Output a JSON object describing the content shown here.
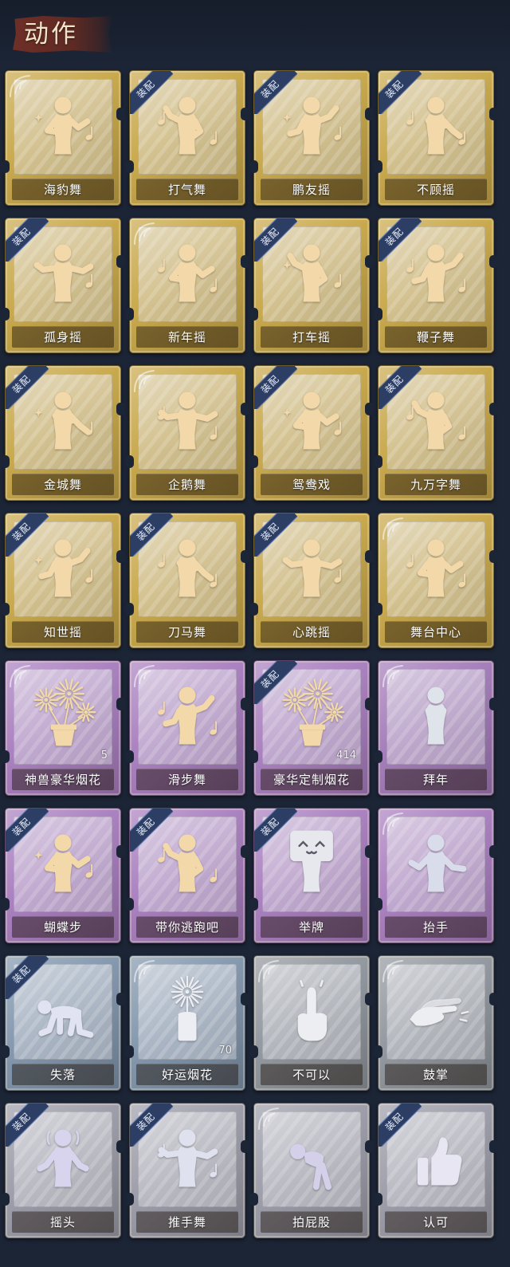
{
  "header": {
    "title": "动作"
  },
  "equip_badge_label": "装配",
  "colors": {
    "page_background": "#1c2536",
    "banner": "#5e2a24",
    "badge": "#2c3e64",
    "label_text": "#ffffff"
  },
  "actions": [
    {
      "name": "海豹舞",
      "equipped": false,
      "icon": "dancing-figure-icon",
      "color": "#c7a646",
      "icon_color": "#f3d8a9"
    },
    {
      "name": "打气舞",
      "equipped": true,
      "icon": "dancing-figure-icon",
      "color": "#c7a646",
      "icon_color": "#f3d8a9"
    },
    {
      "name": "鹏友摇",
      "equipped": true,
      "icon": "dancing-figure-icon",
      "color": "#c7a646",
      "icon_color": "#f3d8a9"
    },
    {
      "name": "不顾摇",
      "equipped": true,
      "icon": "dancing-figure-icon",
      "color": "#c7a646",
      "icon_color": "#f3d8a9"
    },
    {
      "name": "孤身摇",
      "equipped": true,
      "icon": "dancing-figure-icon",
      "color": "#c7a646",
      "icon_color": "#f3d8a9"
    },
    {
      "name": "新年摇",
      "equipped": false,
      "icon": "dancing-figure-icon",
      "color": "#c7a646",
      "icon_color": "#f3d8a9"
    },
    {
      "name": "打车摇",
      "equipped": true,
      "icon": "dancing-figure-icon",
      "color": "#c7a646",
      "icon_color": "#f3d8a9"
    },
    {
      "name": "鞭子舞",
      "equipped": true,
      "icon": "dancing-figure-icon",
      "color": "#c7a646",
      "icon_color": "#f3d8a9"
    },
    {
      "name": "金城舞",
      "equipped": true,
      "icon": "dancing-figure-icon",
      "color": "#c7a646",
      "icon_color": "#f3d8a9"
    },
    {
      "name": "企鹅舞",
      "equipped": false,
      "icon": "dancing-figure-icon",
      "color": "#c7a646",
      "icon_color": "#f3d8a9"
    },
    {
      "name": "鸳鸯戏",
      "equipped": true,
      "icon": "dancing-figure-icon",
      "color": "#c7a646",
      "icon_color": "#f3d8a9"
    },
    {
      "name": "九万字舞",
      "equipped": true,
      "icon": "dancing-figure-icon",
      "color": "#c7a646",
      "icon_color": "#f3d8a9"
    },
    {
      "name": "知世摇",
      "equipped": true,
      "icon": "dancing-figure-icon",
      "color": "#c7a646",
      "icon_color": "#f3d8a9"
    },
    {
      "name": "刀马舞",
      "equipped": true,
      "icon": "dancing-figure-icon",
      "color": "#c7a646",
      "icon_color": "#f3d8a9"
    },
    {
      "name": "心跳摇",
      "equipped": true,
      "icon": "dancing-figure-icon",
      "color": "#c7a646",
      "icon_color": "#f3d8a9"
    },
    {
      "name": "舞台中心",
      "equipped": false,
      "icon": "dancing-figure-icon",
      "color": "#c7a646",
      "icon_color": "#f3d8a9"
    },
    {
      "name": "神兽豪华烟花",
      "equipped": false,
      "icon": "fireworks-icon",
      "color": "#a77cbe",
      "icon_color": "#f3d8a9",
      "count": 5
    },
    {
      "name": "滑步舞",
      "equipped": false,
      "icon": "dancing-figure-icon",
      "color": "#a77cbe",
      "icon_color": "#f3d8a9"
    },
    {
      "name": "豪华定制烟花",
      "equipped": true,
      "icon": "fireworks-icon",
      "color": "#a77cbe",
      "icon_color": "#f3d8a9",
      "count": 414
    },
    {
      "name": "拜年",
      "equipped": false,
      "icon": "greeting-figure-icon",
      "color": "#a179b8",
      "icon_color": "#dfe3ea"
    },
    {
      "name": "蝴蝶步",
      "equipped": true,
      "icon": "dancing-figure-icon",
      "color": "#a77cbe",
      "icon_color": "#f3d8a9"
    },
    {
      "name": "带你逃跑吧",
      "equipped": true,
      "icon": "dancing-figure-icon",
      "color": "#a77cbe",
      "icon_color": "#f3d8a9"
    },
    {
      "name": "举牌",
      "equipped": true,
      "icon": "sign-holding-figure-icon",
      "color": "#a77cbe",
      "icon_color": "#e6e8ee"
    },
    {
      "name": "抬手",
      "equipped": false,
      "icon": "raised-hand-figure-icon",
      "color": "#a77cbe",
      "icon_color": "#d9dcea"
    },
    {
      "name": "失落",
      "equipped": true,
      "icon": "crawling-figure-icon",
      "color": "#7f94ab",
      "icon_color": "#e2e3f2"
    },
    {
      "name": "好运烟花",
      "equipped": false,
      "icon": "firecracker-icon",
      "color": "#7f94ab",
      "icon_color": "#eceef3",
      "count": 70
    },
    {
      "name": "不可以",
      "equipped": false,
      "icon": "pointing-finger-icon",
      "color": "#8f959d",
      "icon_color": "#eceef2"
    },
    {
      "name": "鼓掌",
      "equipped": false,
      "icon": "clapping-hands-icon",
      "color": "#8f959d",
      "icon_color": "#eceef2"
    },
    {
      "name": "摇头",
      "equipped": true,
      "icon": "shaking-head-figure-icon",
      "color": "#9b9ba8",
      "icon_color": "#d8d4ee"
    },
    {
      "name": "推手舞",
      "equipped": true,
      "icon": "dancing-figure-icon",
      "color": "#9b9ba8",
      "icon_color": "#dfe2ee"
    },
    {
      "name": "拍屁股",
      "equipped": false,
      "icon": "bent-over-figure-icon",
      "color": "#9b9ba8",
      "icon_color": "#d4d0ea"
    },
    {
      "name": "认可",
      "equipped": true,
      "icon": "thumbs-up-icon",
      "color": "#9b9ba8",
      "icon_color": "#e8e6f2"
    }
  ]
}
